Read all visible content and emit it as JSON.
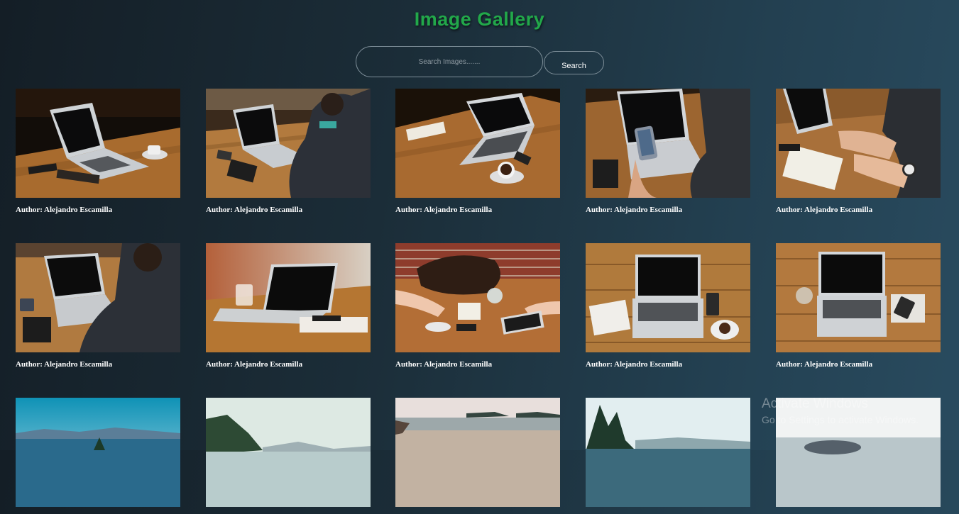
{
  "header": {
    "title": "Image Gallery"
  },
  "search": {
    "placeholder": "Search Images.......",
    "value": "",
    "button_label": "Search"
  },
  "gallery": {
    "items": [
      {
        "author": "Author: Alejandro Escamilla"
      },
      {
        "author": "Author: Alejandro Escamilla"
      },
      {
        "author": "Author: Alejandro Escamilla"
      },
      {
        "author": "Author: Alejandro Escamilla"
      },
      {
        "author": "Author: Alejandro Escamilla"
      },
      {
        "author": "Author: Alejandro Escamilla"
      },
      {
        "author": "Author: Alejandro Escamilla"
      },
      {
        "author": "Author: Alejandro Escamilla"
      },
      {
        "author": "Author: Alejandro Escamilla"
      },
      {
        "author": "Author: Alejandro Escamilla"
      },
      {
        "author": ""
      },
      {
        "author": ""
      },
      {
        "author": ""
      },
      {
        "author": ""
      },
      {
        "author": ""
      }
    ]
  },
  "watermark": {
    "line1": "Activate Windows",
    "line2": "Go to Settings to activate Windows."
  },
  "colors": {
    "accent_title": "#22a84a",
    "background_start": "#141e26",
    "background_end": "#294b5f"
  }
}
